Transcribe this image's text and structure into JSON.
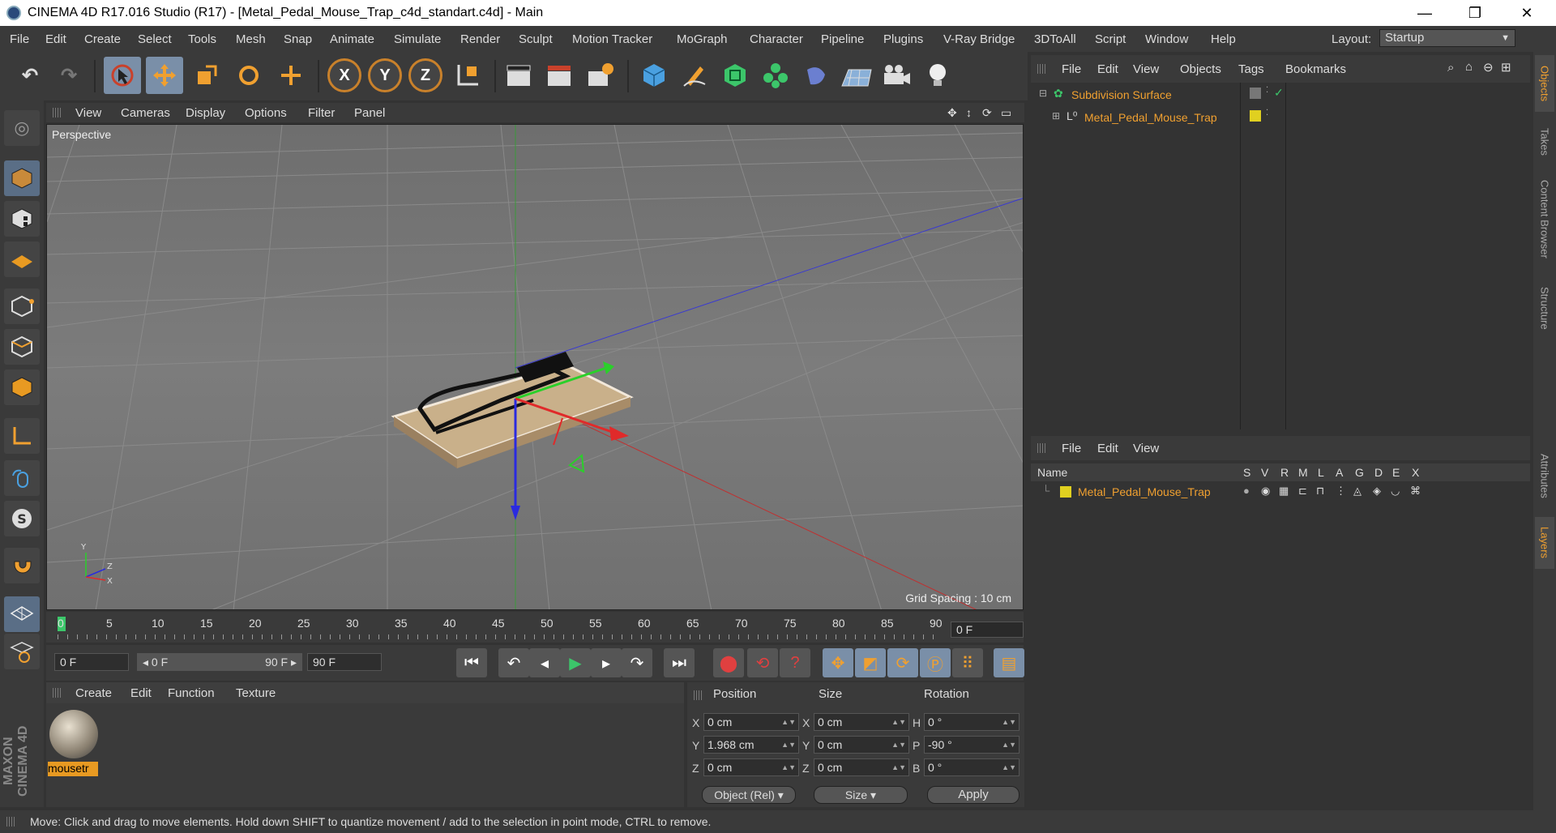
{
  "window": {
    "title": "CINEMA 4D R17.016 Studio (R17) - [Metal_Pedal_Mouse_Trap_c4d_standart.c4d] - Main",
    "minimize": "—",
    "maximize": "❐",
    "close": "✕"
  },
  "menubar": {
    "items": [
      "File",
      "Edit",
      "Create",
      "Select",
      "Tools",
      "Mesh",
      "Snap",
      "Animate",
      "Simulate",
      "Render",
      "Sculpt",
      "Motion Tracker",
      "MoGraph",
      "Character",
      "Pipeline",
      "Plugins",
      "V-Ray Bridge",
      "3DToAll",
      "Script",
      "Window",
      "Help"
    ],
    "layout_label": "Layout:",
    "layout_value": "Startup"
  },
  "toolbar": {
    "undo": "↶",
    "redo": "↷",
    "axis_x": "X",
    "axis_y": "Y",
    "axis_z": "Z"
  },
  "viewport": {
    "menu": [
      "View",
      "Cameras",
      "Display",
      "Options",
      "Filter",
      "Panel"
    ],
    "label": "Perspective",
    "grid_spacing": "Grid Spacing : 10 cm"
  },
  "timeline": {
    "ticks": [
      "0",
      "5",
      "10",
      "15",
      "20",
      "25",
      "30",
      "35",
      "40",
      "45",
      "50",
      "55",
      "60",
      "65",
      "70",
      "75",
      "80",
      "85",
      "90"
    ],
    "current_frame": "0 F"
  },
  "transport": {
    "start_frame": "0 F",
    "range_start": "◂ 0 F",
    "range_end": "90 F ▸",
    "end_frame": "90 F"
  },
  "material": {
    "menu": [
      "Create",
      "Edit",
      "Function",
      "Texture"
    ],
    "name": "mousetr"
  },
  "coordinates": {
    "headers": [
      "Position",
      "Size",
      "Rotation"
    ],
    "rows": [
      {
        "pl": "X",
        "pv": "0 cm",
        "sl": "X",
        "sv": "0 cm",
        "rl": "H",
        "rv": "0 °"
      },
      {
        "pl": "Y",
        "pv": "1.968 cm",
        "sl": "Y",
        "sv": "0 cm",
        "rl": "P",
        "rv": "-90 °"
      },
      {
        "pl": "Z",
        "pv": "0 cm",
        "sl": "Z",
        "sv": "0 cm",
        "rl": "B",
        "rv": "0 °"
      }
    ],
    "mode": "Object (Rel)",
    "size_mode": "Size",
    "apply": "Apply"
  },
  "objects": {
    "menu": [
      "File",
      "Edit",
      "View",
      "Objects",
      "Tags",
      "Bookmarks"
    ],
    "items": [
      {
        "name": "Subdivision Surface"
      },
      {
        "name": "Metal_Pedal_Mouse_Trap"
      }
    ]
  },
  "layers": {
    "menu": [
      "File",
      "Edit",
      "View"
    ],
    "columns": [
      "Name",
      "S",
      "V",
      "R",
      "M",
      "L",
      "A",
      "G",
      "D",
      "E",
      "X"
    ],
    "row_name": "Metal_Pedal_Mouse_Trap"
  },
  "right_tabs": [
    "Objects",
    "Takes",
    "Content Browser",
    "Structure",
    "Attributes",
    "Layers"
  ],
  "status": "Move: Click and drag to move elements. Hold down SHIFT to quantize movement / add to the selection in point mode, CTRL to remove.",
  "brand": "MAXON CINEMA 4D",
  "colors": {
    "accent": "#f0a030",
    "active": "#7a8fa8"
  }
}
